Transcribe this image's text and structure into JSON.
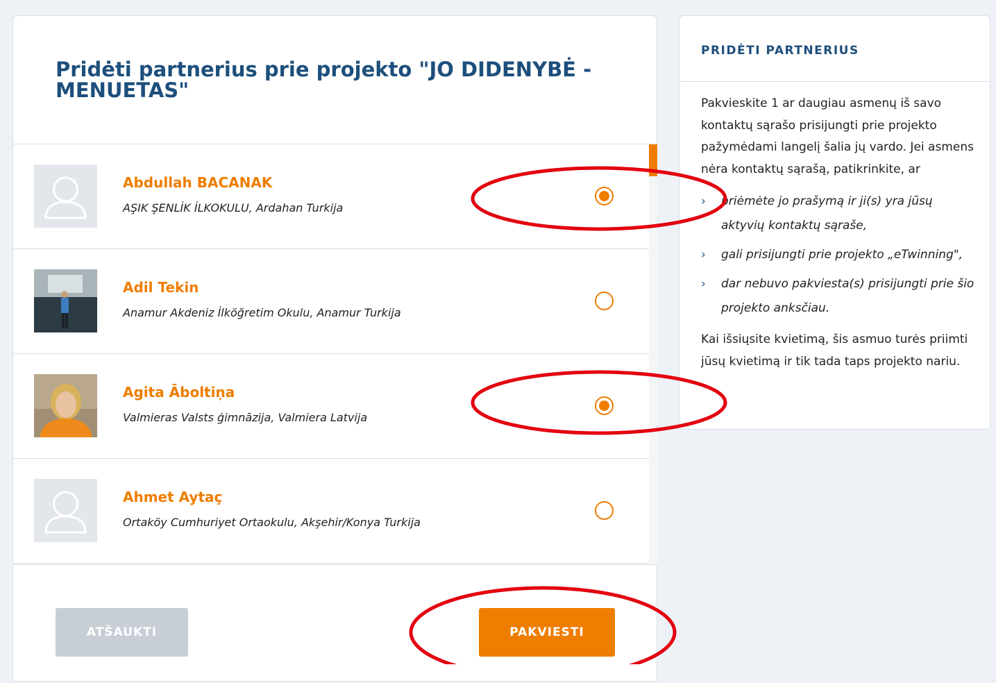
{
  "main": {
    "title": "Pridėti partnerius prie projekto \"JO DIDENYBĖ - MENUETAS\"",
    "partners": [
      {
        "name": "Abdullah BACANAK",
        "school": "AŞIK ŞENLİK İLKOKULU, Ardahan Turkija",
        "selected": true,
        "avatar": "placeholder"
      },
      {
        "name": "Adil Tekin",
        "school": "Anamur Akdeniz İlköğretim Okulu, Anamur Turkija",
        "selected": false,
        "avatar": "photo"
      },
      {
        "name": "Agita Āboltiņa",
        "school": "Valmieras Valsts ģimnāzija, Valmiera Latvija",
        "selected": true,
        "avatar": "photo"
      },
      {
        "name": "Ahmet Aytaç",
        "school": "Ortaköy Cumhuriyet Ortaokulu, Akşehir/Konya Turkija",
        "selected": false,
        "avatar": "placeholder"
      }
    ],
    "cancel_label": "ATŠAUKTI",
    "invite_label": "PAKVIESTI"
  },
  "sidebar": {
    "title": "PRIDĖTI PARTNERIUS",
    "intro": "Pakvieskite 1 ar daugiau asmenų iš savo kontaktų sąrašo prisijungti prie projekto pažymėdami langelį šalia jų vardo. Jei asmens nėra kontaktų sąrašą, patikrinkite, ar",
    "items": [
      "priėmėte jo prašymą ir ji(s) yra jūsų aktyvių kontaktų sąraše,",
      "gali prisijungti prie projekto „eTwinning\",",
      "dar nebuvo pakviesta(s) prisijungti prie šio projekto anksčiau."
    ],
    "outro": "Kai išsiųsite kvietimą, šis asmuo turės priimti jūsų kvietimą ir tik tada taps projekto nariu."
  },
  "colors": {
    "accent": "#ee7d00",
    "title": "#1d4f7c",
    "annotation": "#e3000f"
  }
}
